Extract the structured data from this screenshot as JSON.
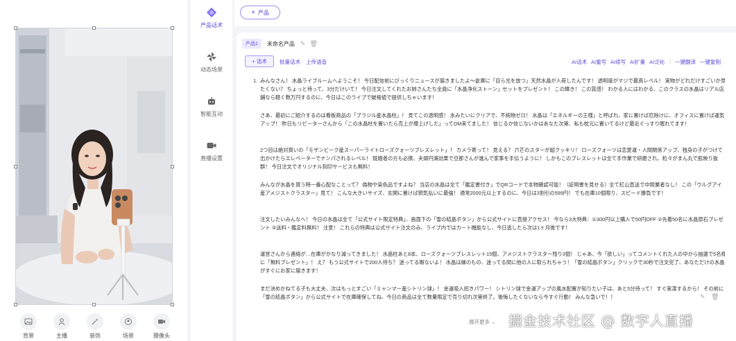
{
  "bottom_tools": [
    {
      "label": "背景",
      "icon": "image-icon"
    },
    {
      "label": "主播",
      "icon": "person-icon"
    },
    {
      "label": "装饰",
      "icon": "sparkle-icon"
    },
    {
      "label": "场景",
      "icon": "scene-icon"
    },
    {
      "label": "摄像头",
      "icon": "camera-icon"
    }
  ],
  "nav": [
    {
      "label": "产品话术",
      "icon": "diamond-icon",
      "active": true
    },
    {
      "label": "动态场景",
      "icon": "pinwheel-icon",
      "active": false
    },
    {
      "label": "智能互动",
      "icon": "robot-icon",
      "active": false
    },
    {
      "label": "直播设置",
      "icon": "video-icon",
      "active": false
    }
  ],
  "topbar": {
    "product_button": "产品",
    "plus": "+"
  },
  "card": {
    "tab_pill": "产品1",
    "tab_name": "未命名产品"
  },
  "toolbar": {
    "huashu_button": "+ 话术",
    "batch": "批量话术",
    "upload": "上传语音",
    "ai_script": "AI话术",
    "ai_rewrite": "AI重写",
    "ai_continue": "AI续写",
    "ai_expand": "AI扩量",
    "ai_paraphrase": "AI泛化",
    "translate": "一键翻译",
    "copy": "一键复制"
  },
  "script": {
    "number": "1.",
    "paragraphs": [
      "みんなさん！ 水晶ライブルームへようこそ！ 今日配信前にびっくりニュースが届きましたよ～倉庫に「自ら光を放つ」天然水晶が入荷したんです！ 透明度がマジで最高レベル！ 実物がどれだけすごいか見たくない？ ちょっと待って、3分だけいて！ 今日注文してくれたお姉さんたち全員に「水晶浄化ストーン」セットをプレゼント！ この輝き！ この質感！ わかる人にはわかる、このクラスの水晶はリアル店舗なら軽く数万円するのに、今日はこのライブで破格値で提供しちゃいます！",
      "さあ、最初にご紹介するのは看板商品の「ブラジル産水晶柱」！ 見てこの透明感！ 氷みたいにクリアで、不純物ゼロ！ 水晶は「エネルギーの王様」と呼ばれ、家に置けば厄除けに、オフィスに置けば運気アップ！ 昨日もリピーターさんから「この水晶柱を置いたら売上が爆上げした」ってDM来てました！ 信じるか信じないかはあなた次第、私も枕元に置いてるけど最近ぐっすり眠れてます！",
      "2つ目は絶対買いの「モザンビーク産スーパーライトローズクォーツブレスレット」！ カメラ寄って！ 見える？ 六芒のスターが超クッキリ！ ローズクォーツは恋愛運・人間関係アップ、独身の子がつけて出かけたらエレベーターでナンパされるレベル！ 既婚者の方も必携、夫婦円満効果で旦那さんが進んで家事を手伝うように！ しかもこのブレスレットは全て手作業で研磨され、粒々がまん丸で肌映り抜群！ 今日注文でオリジナル刻印サービスも無料！",
      "みんなが水晶を買う時一番心配なことって？ 偽物や染色品ですよね？ 当店の水晶は全て「鑑定書付き」でQRコードで本物確認可能！（証明書を見せる）全て紅山直送で中間業者なし！ この「ウルグアイ産アメジストクラスター」見て！ こんな大きいサイズ、玄関に置けば邪気払いに最強！ 通常2000元以上するのに、今日は3割引の599円！ でも在庫10個限り、スピード勝負です！",
      "注文したいみんなへ！ 今日の水晶は全て「公式サイト限定特典」、画面下の「雪の結晶ボタン」から公式サイトに直接アクセス！ 今なら3大特典：①300円以上購入で50円OFF ②先着50名に水晶原石プレゼント ③送料・鑑定料無料！ 注意！ これらの特典は公式サイト注文のみ、ライブ内ではカート機能なし、今日逃したら次は1ヶ月後です！",
      "運営さんから連絡が…在庫がかなり減ってきました！ 水晶柱あと8本、ローズクォーツブレスレット15個、アメジストクラスター残り3個！ じゃあ、今「欲しい」ってコメントくれた人の中から抽選で5名様に「無料プレゼント」！ え？ もう公式サイトで200人待ち？ 迷ってる暇ないよ！ 水晶は縁のもの、迷ってる間に他の人に取られちゃう！「雪の結晶ボタン」クリックで30秒で注文完了、あなただけの水晶がすぐにお家に届きます！",
      "まだ決めかねてる子も大丈夫、次はもっとすごい「ミャンマー産シトリン球」！ 金運吸入招きパワー！ シトリン球で金運アップの風水配置が知りたい子は、あと5分待って！ すぐ実演するから！ その前に「雪の結晶ボタン」から公式サイトで在庫確保してね、今日の商品は全て数量限定で売り切れ次第終了。後悔したくないなら今すぐ行動！ みんな急いで！！"
    ]
  },
  "expand_label": "展开更多 ⌄",
  "watermark": "掘金技术社区 @ 数字人直播",
  "colors": {
    "accent": "#5b4bd6",
    "accent_light": "#ece9fd",
    "background": "#f3f4f8"
  }
}
